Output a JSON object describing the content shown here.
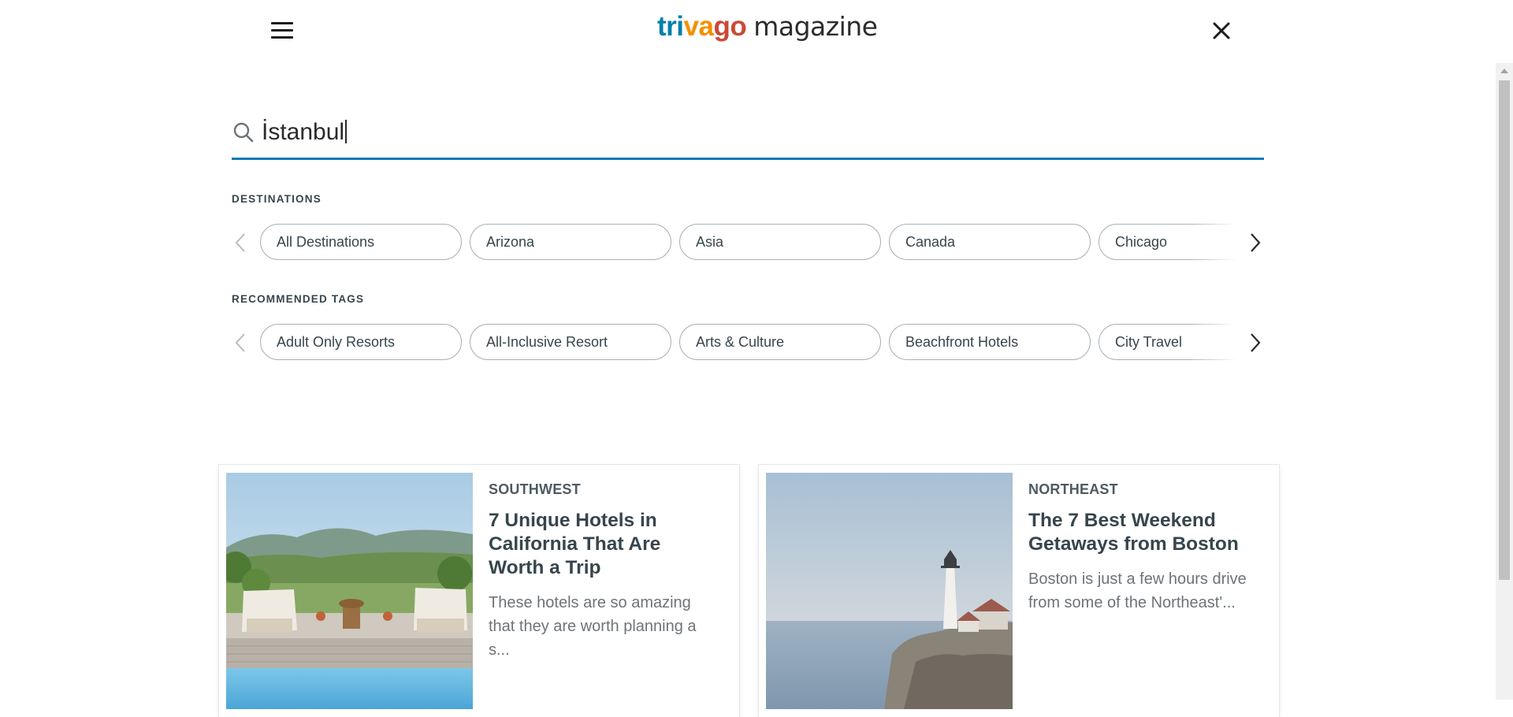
{
  "header": {
    "logo_parts": [
      "tri",
      "va",
      "go"
    ],
    "logo_suffix": "magazine",
    "colors": {
      "tri": "#007fad",
      "va": "#f48f00",
      "go": "#c94a38"
    }
  },
  "search": {
    "value": "İstanbul",
    "placeholder": "",
    "accent": "#0a7cb8"
  },
  "destinations": {
    "label": "DESTINATIONS",
    "chips": [
      "All Destinations",
      "Arizona",
      "Asia",
      "Canada",
      "Chicago"
    ]
  },
  "tags": {
    "label": "RECOMMENDED TAGS",
    "chips": [
      "Adult Only Resorts",
      "All-Inclusive Resort",
      "Arts & Culture",
      "Beachfront Hotels",
      "City Travel"
    ]
  },
  "articles": [
    {
      "category": "SOUTHWEST",
      "title": "7 Unique Hotels in California That Are Worth a Trip",
      "excerpt": "These hotels are so amazing that they are worth planning a s..."
    },
    {
      "category": "NORTHEAST",
      "title": "The 7 Best Weekend Getaways from Boston",
      "excerpt": "Boston is just a few hours drive from some of the Northeast'..."
    }
  ],
  "icons": {
    "menu": "hamburger-menu-icon",
    "close": "close-icon",
    "search": "search-icon",
    "prev": "chevron-left-icon",
    "next": "chevron-right-icon"
  }
}
